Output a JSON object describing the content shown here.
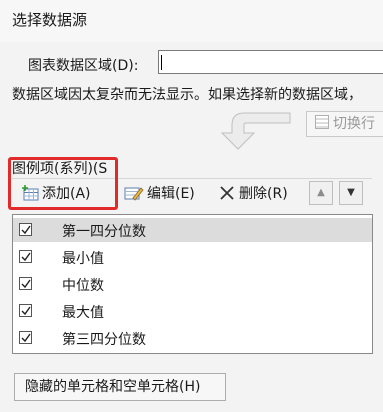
{
  "dialog": {
    "title": "选择数据源"
  },
  "range": {
    "label": "图表数据区域(D):",
    "value": "",
    "note": "数据区域因太复杂而无法显示。如果选择新的数据区域，"
  },
  "switch_button": {
    "label": "切换行"
  },
  "legend": {
    "label": "图例项(系列)(S",
    "add_label": "添加(A)",
    "edit_label": "编辑(E)",
    "delete_label": "删除(R)",
    "up_label": "▲",
    "down_label": "▼",
    "items": [
      {
        "label": "第一四分位数",
        "checked": true
      },
      {
        "label": "最小值",
        "checked": true
      },
      {
        "label": "中位数",
        "checked": true
      },
      {
        "label": "最大值",
        "checked": true
      },
      {
        "label": "第三四分位数",
        "checked": true
      }
    ]
  },
  "hidden_cells_button": {
    "label": "隐藏的单元格和空单元格(H)"
  },
  "colors": {
    "highlight": "#e12a2a",
    "selected_row": "#dcdcdc"
  },
  "icons": [
    "add-series-icon",
    "edit-series-icon",
    "delete-x-icon",
    "switch-row-col-icon",
    "curved-arrow-icon",
    "checkbox-check-icon"
  ]
}
